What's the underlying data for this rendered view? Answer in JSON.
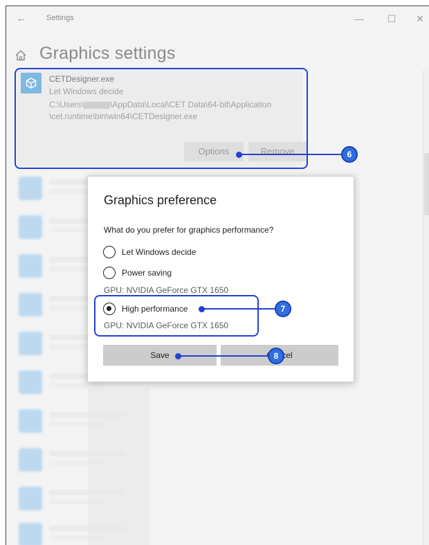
{
  "window": {
    "title": "Settings",
    "back_glyph": "←",
    "minimize_glyph": "—",
    "maximize_glyph": "☐",
    "close_glyph": "✕"
  },
  "page": {
    "title": "Graphics settings",
    "home_icon": "home-icon"
  },
  "app_entry": {
    "name": "CETDesigner.exe",
    "preference": "Let Windows decide",
    "path_prefix": "C:\\Users\\",
    "path_suffix": "\\AppData\\Local\\CET Data\\64-bit\\Application",
    "path_line2": "\\cet.runtime\\bin\\win64\\CETDesigner.exe",
    "options_label": "Options",
    "remove_label": "Remove",
    "icon": "app-cube-icon"
  },
  "dialog": {
    "title": "Graphics preference",
    "question": "What do you prefer for graphics performance?",
    "options": [
      {
        "label": "Let Windows decide",
        "selected": false
      },
      {
        "label": "Power saving",
        "selected": false,
        "gpu": "GPU: NVIDIA GeForce GTX 1650"
      },
      {
        "label": "High performance",
        "selected": true,
        "gpu": "GPU: NVIDIA GeForce GTX 1650"
      }
    ],
    "save_label": "Save",
    "cancel_label": "Cancel"
  },
  "callouts": {
    "step6": "6",
    "step7": "7",
    "step8": "8"
  },
  "colors": {
    "callout": "#2341d4",
    "badge": "#2f6fe0",
    "app_icon": "#7fb8e0"
  }
}
